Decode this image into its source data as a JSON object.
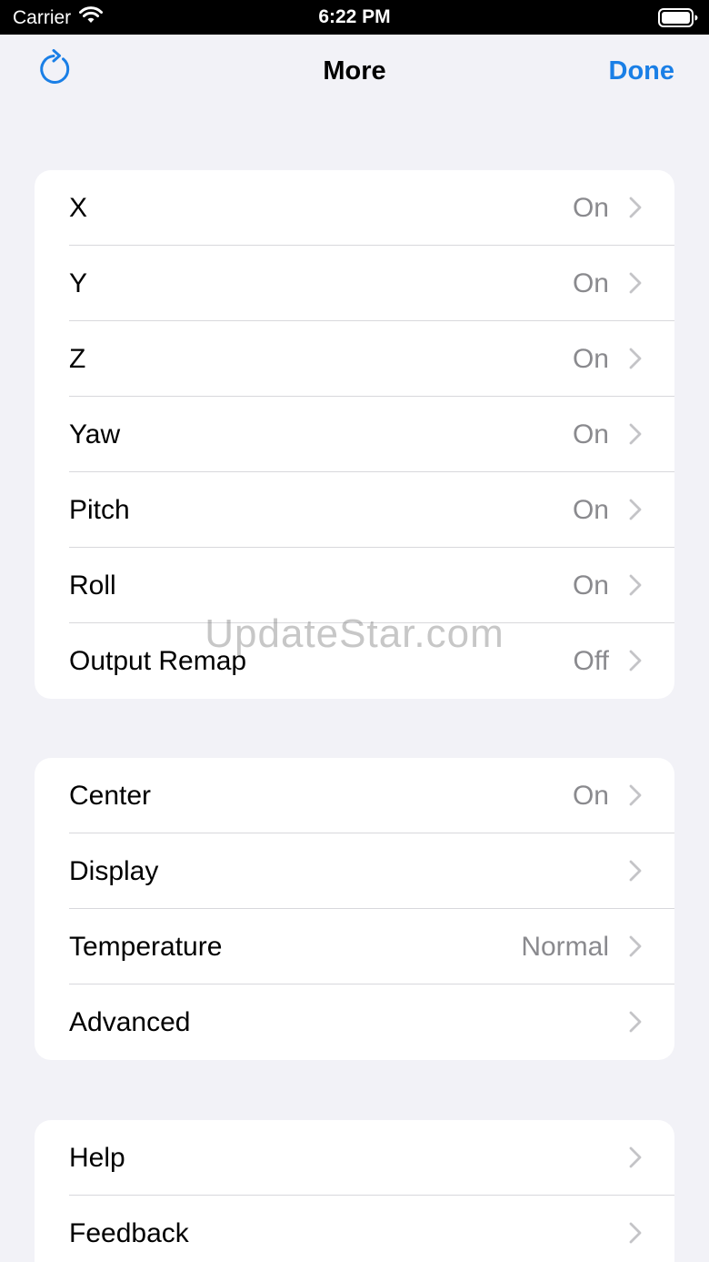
{
  "status_bar": {
    "carrier": "Carrier",
    "time": "6:22 PM",
    "wifi_icon": "wifi-icon",
    "battery_icon": "battery-icon"
  },
  "nav": {
    "title": "More",
    "done_label": "Done",
    "refresh_icon": "refresh-icon",
    "accent_color": "#1a7fe6"
  },
  "groups": [
    {
      "rows": [
        {
          "label": "X",
          "value": "On"
        },
        {
          "label": "Y",
          "value": "On"
        },
        {
          "label": "Z",
          "value": "On"
        },
        {
          "label": "Yaw",
          "value": "On"
        },
        {
          "label": "Pitch",
          "value": "On"
        },
        {
          "label": "Roll",
          "value": "On"
        },
        {
          "label": "Output Remap",
          "value": "Off"
        }
      ]
    },
    {
      "rows": [
        {
          "label": "Center",
          "value": "On"
        },
        {
          "label": "Display",
          "value": ""
        },
        {
          "label": "Temperature",
          "value": "Normal"
        },
        {
          "label": "Advanced",
          "value": ""
        }
      ]
    },
    {
      "rows": [
        {
          "label": "Help",
          "value": ""
        },
        {
          "label": "Feedback",
          "value": ""
        }
      ]
    }
  ],
  "watermark": "UpdateStar.com"
}
